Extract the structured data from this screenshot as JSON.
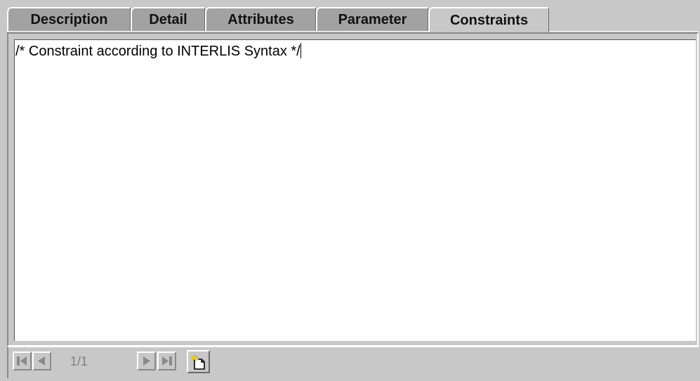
{
  "tabs": [
    {
      "label": "Description",
      "active": false
    },
    {
      "label": "Detail",
      "active": false
    },
    {
      "label": "Attributes",
      "active": false
    },
    {
      "label": "Parameter",
      "active": false
    },
    {
      "label": "Constraints",
      "active": true
    }
  ],
  "editor": {
    "text": "/* Constraint according to INTERLIS Syntax */"
  },
  "navigator": {
    "page_label": "1/1",
    "first_icon": "first-page-icon",
    "prev_icon": "previous-page-icon",
    "next_icon": "next-page-icon",
    "last_icon": "last-page-icon",
    "new_icon": "new-document-icon"
  },
  "colors": {
    "panel_bg": "#c8c8c8",
    "inactive_tab_bg": "#a2a2a2",
    "editor_bg": "#ffffff",
    "disabled_text": "#808080",
    "new_icon_star": "#f5d000"
  }
}
